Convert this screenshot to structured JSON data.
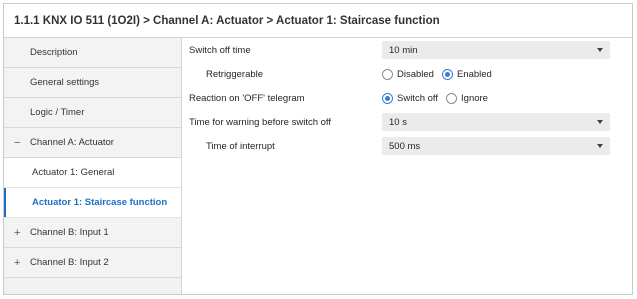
{
  "breadcrumb": "1.1.1 KNX IO 511 (1O2I) > Channel A: Actuator > Actuator 1: Staircase function",
  "sidebar": {
    "items": [
      {
        "label": "Description"
      },
      {
        "label": "General settings"
      },
      {
        "label": "Logic / Timer"
      },
      {
        "label": "Channel A: Actuator",
        "expander": "−"
      },
      {
        "label": "Actuator 1: General"
      },
      {
        "label": "Actuator 1: Staircase function"
      },
      {
        "label": "Channel B: Input 1",
        "expander": "+"
      },
      {
        "label": "Channel B: Input 2",
        "expander": "+"
      }
    ]
  },
  "params": {
    "switch_off_time": {
      "label": "Switch off time",
      "value": "10 min"
    },
    "retriggerable": {
      "label": "Retriggerable",
      "options": [
        "Disabled",
        "Enabled"
      ],
      "selected": "Enabled"
    },
    "reaction_off": {
      "label": "Reaction on 'OFF' telegram",
      "options": [
        "Switch off",
        "Ignore"
      ],
      "selected": "Switch off"
    },
    "warning_time": {
      "label": "Time for warning before switch off",
      "value": "10 s"
    },
    "interrupt_time": {
      "label": "Time of interrupt",
      "value": "500 ms"
    }
  }
}
